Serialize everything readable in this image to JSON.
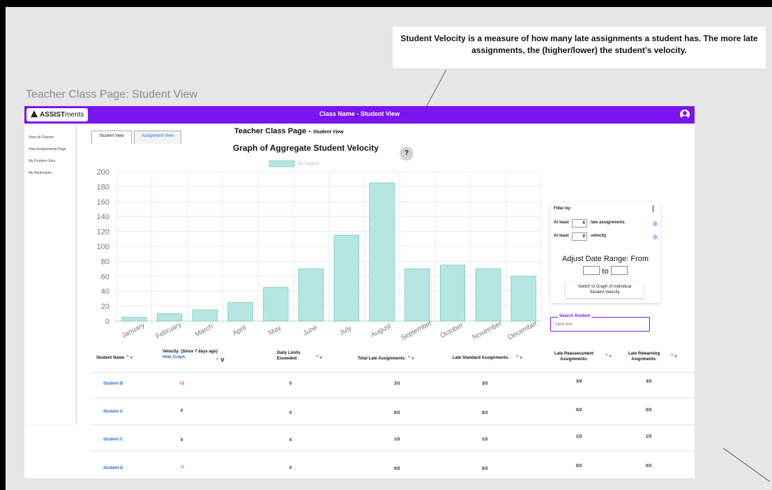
{
  "annotation": {
    "callout_text": "Student Velocity is a measure of how many late assignments a student has. The more late assignments, the (higher/lower) the student’s velocity.",
    "frame_title": "Teacher Class Page: Student View"
  },
  "app": {
    "logo_bold": "ASSIST",
    "logo_light": "ments",
    "header_title": "Class Name - Student View"
  },
  "sidebar": {
    "items": [
      {
        "label": "View all Classes"
      },
      {
        "label": "View Assignments Page"
      },
      {
        "label": "My Problem Sets"
      },
      {
        "label": "My Bookmarks"
      }
    ]
  },
  "tabs": [
    {
      "label": "Student View"
    },
    {
      "label": "Assignment View"
    }
  ],
  "page": {
    "heading": "Teacher Class Page - ",
    "heading_small": "Student View",
    "graph_title": "Graph of Aggregate Student Velocity",
    "help_glyph": "?"
  },
  "chart_data": {
    "type": "bar",
    "categories": [
      "January",
      "February",
      "March",
      "April",
      "May",
      "June",
      "July",
      "August",
      "September",
      "October",
      "November",
      "December"
    ],
    "values": [
      5,
      10,
      15,
      25,
      45,
      70,
      115,
      185,
      70,
      75,
      70,
      60
    ],
    "ylim": [
      0,
      200
    ],
    "yticks": [
      0,
      20,
      40,
      60,
      80,
      100,
      120,
      140,
      160,
      180,
      200
    ],
    "grid": true,
    "bar_color": "#b6e6e2",
    "bar_stroke": "#6ec8c0",
    "legend_label": "My Dataset",
    "legend_position": "top"
  },
  "filter": {
    "title": "Filter by:",
    "late_prefix": "At least",
    "late_value": "0",
    "late_suffix": "late assignments",
    "velocity_prefix": "At least",
    "velocity_value": "0",
    "velocity_suffix": "velocity",
    "date_range_title": "Adjust Date Range: From",
    "date_to": "to",
    "switch_button_line1": "Switch to Graph of Individual",
    "switch_button_line2": "Student Velocity"
  },
  "search": {
    "label": "Search Student",
    "placeholder": "Input text"
  },
  "table": {
    "headers": {
      "student_name": "Student Name",
      "velocity": "Velocity: (Since 7 days ago)",
      "hide_graph": "Hide Graph",
      "daily_limits_1": "Daily Limits",
      "daily_limits_2": "Exceeded:",
      "total_late": "Total Late Assignments:",
      "late_standard": "Late Standard Assignments:",
      "late_reassess_1": "Late Reassessment",
      "late_reassess_2": "Assignments:",
      "late_relearn_1": "Late Relearning",
      "late_relearn_2": "Asignments:",
      "sort_glyph": "^ v"
    },
    "rows": [
      {
        "name": "Student B",
        "velocity": "+3",
        "daily": "0",
        "total": "3/3",
        "standard": "3/3",
        "reassess": "3/3",
        "relearn": "3/3"
      },
      {
        "name": "Student A",
        "velocity": "0",
        "daily": "0",
        "total": "0/3",
        "standard": "0/3",
        "reassess": "0/3",
        "relearn": "0/3"
      },
      {
        "name": "Student C",
        "velocity": "0",
        "daily": "0",
        "total": "1/3",
        "standard": "1/3",
        "reassess": "1/3",
        "relearn": "1/3"
      },
      {
        "name": "Student D",
        "velocity": "-3",
        "daily": "0",
        "total": "0/3",
        "standard": "0/3",
        "reassess": "0/3",
        "relearn": "0/3"
      }
    ]
  }
}
